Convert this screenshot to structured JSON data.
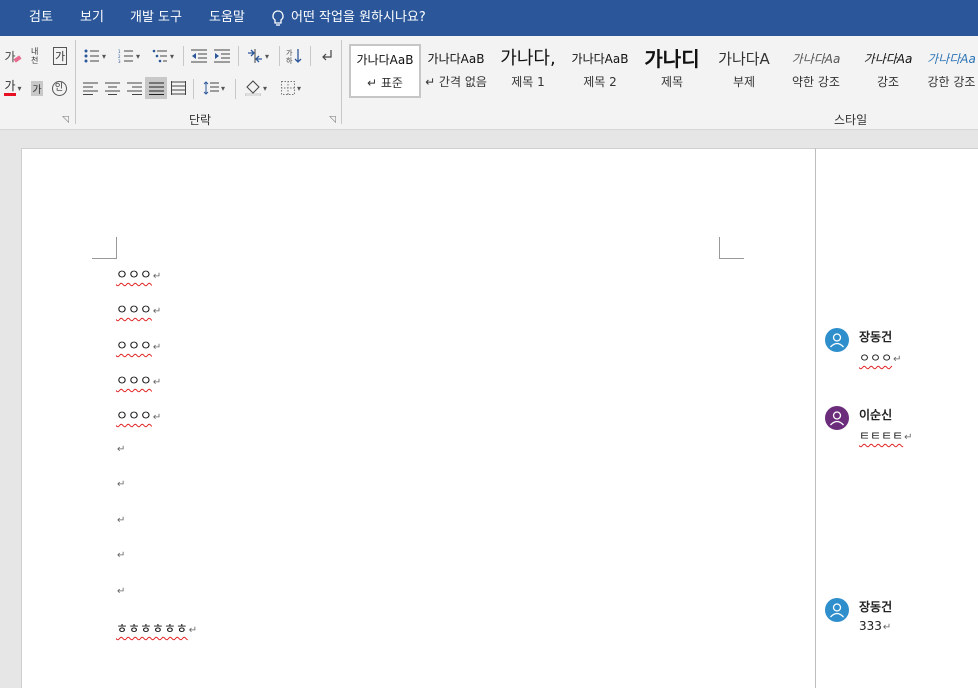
{
  "menu": {
    "items": [
      "검토",
      "보기",
      "개발 도구",
      "도움말"
    ],
    "tell_me": "어떤 작업을 원하시나요?"
  },
  "ribbon": {
    "font_buttons": {
      "clear_format": "가",
      "phonetic": "내천",
      "char_border": "가",
      "font_color": "가",
      "char_shading": "가",
      "enclose": "인"
    },
    "paragraph_label": "단락",
    "styles_label": "스타일",
    "styles": [
      {
        "sample": "가나다AaB",
        "name": "↵ 표준"
      },
      {
        "sample": "가나다AaB",
        "name": "↵ 간격 없음"
      },
      {
        "sample": "가나다,",
        "name": "제목 1"
      },
      {
        "sample": "가나다AaB",
        "name": "제목 2"
      },
      {
        "sample": "가나디",
        "name": "제목"
      },
      {
        "sample": "가나다A",
        "name": "부제"
      },
      {
        "sample": "가나다Aa",
        "name": "약한 강조"
      },
      {
        "sample": "가나다Aa",
        "name": "강조"
      },
      {
        "sample": "가나다Aa",
        "name": "강한 강조"
      }
    ]
  },
  "document": {
    "paragraphs": [
      "ㅇㅇㅇ",
      "ㅇㅇㅇ",
      "ㅇㅇㅇ",
      "ㅇㅇㅇ",
      "ㅇㅇㅇ",
      "",
      "",
      "",
      "",
      "",
      "ㅎㅎㅎㅎㅎㅎ"
    ],
    "paragraph_mark": "↵"
  },
  "comments": [
    {
      "author": "장동건",
      "text": "ㅇㅇㅇ",
      "avatar_color": "#2e8fcc"
    },
    {
      "author": "이순신",
      "text": "ㅌㅌㅌㅌ",
      "avatar_color": "#6b2d7b"
    },
    {
      "author": "장동건",
      "text": "333",
      "avatar_color": "#2e8fcc"
    }
  ],
  "colors": {
    "title_bar": "#2b579a",
    "ribbon_bg": "#f3f3f3",
    "spell_error": "#e02020"
  }
}
